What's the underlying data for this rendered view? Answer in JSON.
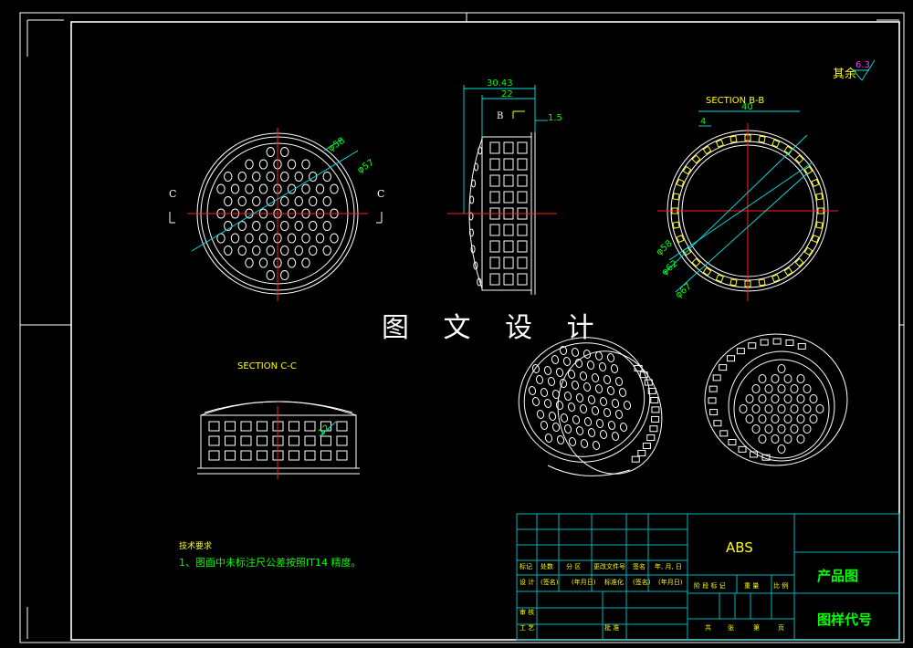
{
  "sheet": {
    "watermark": "图 文 设 计",
    "roughness_prefix": "其余",
    "roughness_value": "6.3"
  },
  "front_view": {
    "section_letter_left": "C",
    "section_letter_right": "C",
    "dim_d58": "φ58",
    "dim_d57": "φ57"
  },
  "side_view": {
    "dim_overall": "30.43",
    "dim_depth": "22",
    "dim_wall": "1.5",
    "section_letter": "B"
  },
  "section_bb": {
    "title": "SECTION B-B",
    "dim_width": "40",
    "dim_rib": "4",
    "dim_d58": "φ58",
    "dim_d62": "φ62",
    "dim_d67": "φ67"
  },
  "section_cc": {
    "title": "SECTION C-C",
    "dim_small": "12"
  },
  "notes": {
    "heading": "技术要求",
    "line1": "1、图面中未标注尺公差按照IT14 精度。"
  },
  "title_block": {
    "material": "ABS",
    "drawing_name": "产品图",
    "drawing_code": "图样代号",
    "row_marks": [
      "标记",
      "处数",
      "分 区",
      "更改文件号",
      "签名",
      "年, 月, 日"
    ],
    "row_design": [
      "设 计",
      "(签名)",
      "(年月日)",
      "标准化",
      "(签名)",
      "(年月日)"
    ],
    "stage_labels": [
      "阶 段 标 记",
      "重 量",
      "比 例"
    ],
    "row_review": "审 核",
    "row_process": "工 艺",
    "row_approve": "批 准",
    "sheet_labels": [
      "共",
      "张",
      "第",
      "页"
    ]
  }
}
